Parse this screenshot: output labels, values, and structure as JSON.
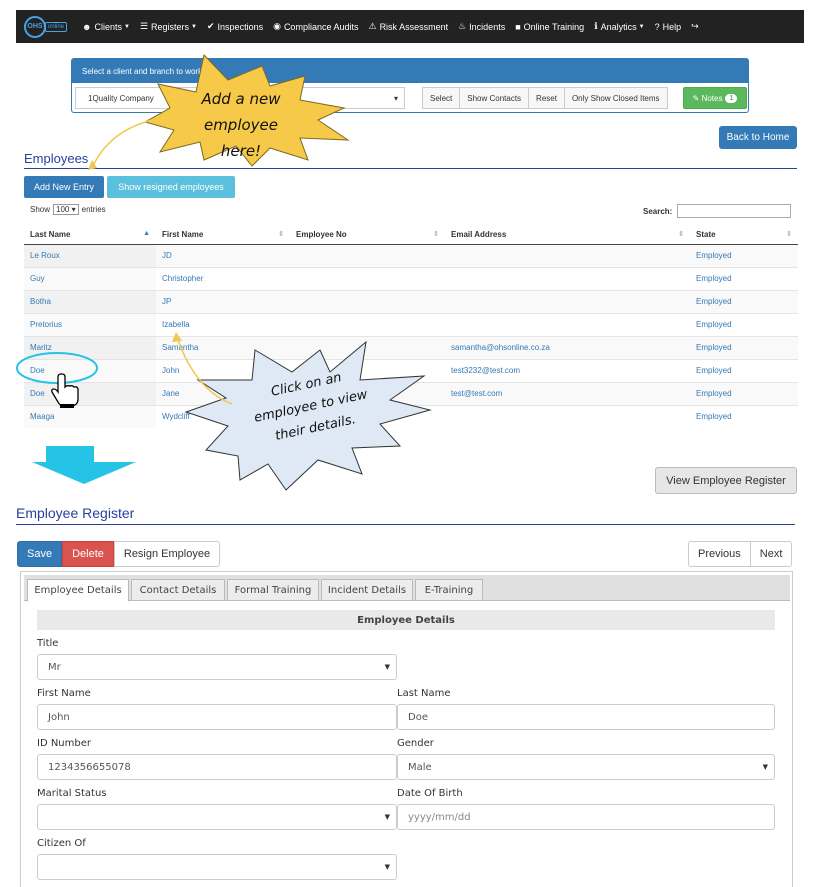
{
  "nav": {
    "logo_main": "OHS",
    "logo_sub": "online",
    "items": [
      {
        "icon": "user-icon",
        "glyph": "☻",
        "label": "Clients",
        "dropdown": true
      },
      {
        "icon": "list-icon",
        "glyph": "☰",
        "label": "Registers",
        "dropdown": true
      },
      {
        "icon": "check-icon",
        "glyph": "✔",
        "label": "Inspections",
        "dropdown": false
      },
      {
        "icon": "eye-icon",
        "glyph": "◉",
        "label": "Compliance Audits",
        "dropdown": false
      },
      {
        "icon": "warning-icon",
        "glyph": "⚠",
        "label": "Risk Assessment",
        "dropdown": false
      },
      {
        "icon": "fire-icon",
        "glyph": "♨",
        "label": "Incidents",
        "dropdown": false
      },
      {
        "icon": "book-icon",
        "glyph": "■",
        "label": "Online Training",
        "dropdown": false
      },
      {
        "icon": "info-icon",
        "glyph": "ℹ",
        "label": "Analytics",
        "dropdown": true
      },
      {
        "icon": "help-icon",
        "glyph": "?",
        "label": "Help",
        "dropdown": false
      },
      {
        "icon": "logout-icon",
        "glyph": "↪",
        "label": "",
        "dropdown": false
      }
    ]
  },
  "client_panel": {
    "heading": "Select a client and branch to work",
    "selected_client": "1Quality Company",
    "buttons": [
      "Select",
      "Show Contacts",
      "Reset",
      "Only Show Closed Items"
    ],
    "notes_label": "Notes",
    "notes_count": "1"
  },
  "back_home_label": "Back to Home",
  "employees": {
    "title": "Employees",
    "add_label": "Add New Entry",
    "resigned_label": "Show resigned employees",
    "show_label": "Show",
    "show_value": "100",
    "entries_label": "entries",
    "search_label": "Search:",
    "columns": [
      "Last Name",
      "First Name",
      "Employee No",
      "Email Address",
      "State"
    ],
    "rows": [
      {
        "last": "Le Roux",
        "first": "JD",
        "no": "",
        "email": "",
        "state": "Employed"
      },
      {
        "last": "Guy",
        "first": "Christopher",
        "no": "",
        "email": "",
        "state": "Employed"
      },
      {
        "last": "Botha",
        "first": "JP",
        "no": "",
        "email": "",
        "state": "Employed"
      },
      {
        "last": "Pretorius",
        "first": "Izabella",
        "no": "",
        "email": "",
        "state": "Employed"
      },
      {
        "last": "Maritz",
        "first": "Samantha",
        "no": "",
        "email": "samantha@ohsonline.co.za",
        "state": "Employed"
      },
      {
        "last": "Doe",
        "first": "John",
        "no": "",
        "email": "test3232@test.com",
        "state": "Employed"
      },
      {
        "last": "Doe",
        "first": "Jane",
        "no": "",
        "email": "test@test.com",
        "state": "Employed"
      },
      {
        "last": "Maaga",
        "first": "Wydcliff",
        "no": "",
        "email": "",
        "state": "Employed"
      }
    ]
  },
  "callouts": {
    "add_line1": "Add a new",
    "add_line2": "employee here!",
    "click_line1": "Click on an",
    "click_line2": "employee to view",
    "click_line3": "their details."
  },
  "view_register_label": "View Employee Register",
  "register": {
    "title": "Employee Register",
    "save": "Save",
    "delete": "Delete",
    "resign": "Resign Employee",
    "previous": "Previous",
    "next": "Next",
    "tabs": [
      "Employee Details",
      "Contact Details",
      "Formal Training",
      "Incident Details",
      "E-Training"
    ],
    "form_heading": "Employee Details",
    "title_label": "Title",
    "title_value": "Mr",
    "first_name_label": "First Name",
    "first_name_value": "John",
    "last_name_label": "Last Name",
    "last_name_value": "Doe",
    "id_label": "ID Number",
    "id_value": "1234356655078",
    "gender_label": "Gender",
    "gender_value": "Male",
    "marital_label": "Marital Status",
    "marital_value": "",
    "dob_label": "Date Of Birth",
    "dob_placeholder": "yyyy/mm/dd",
    "citizen_label": "Citizen Of",
    "citizen_value": ""
  },
  "colors": {
    "primary": "#337ab7",
    "info": "#5bc0de",
    "success": "#5cb85c",
    "danger": "#d9534f",
    "heading": "#2a3f9d",
    "callout_yellow": "#f7c948",
    "callout_blue": "#dfe8f5",
    "highlight_cyan": "#25c3e6"
  }
}
